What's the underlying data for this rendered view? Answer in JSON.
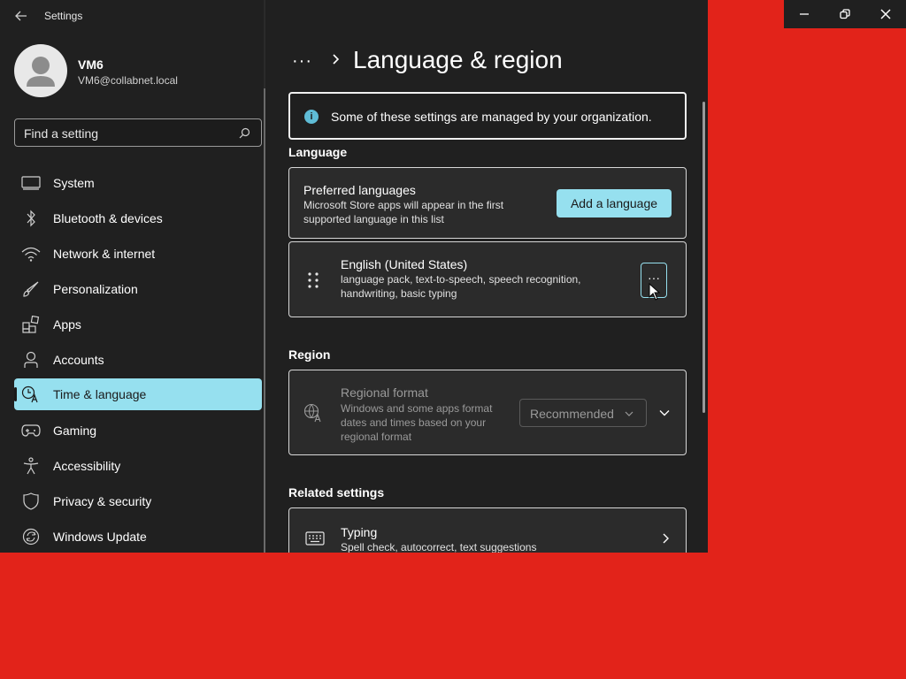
{
  "app": {
    "title": "Settings"
  },
  "user": {
    "name": "VM6",
    "email": "VM6@collabnet.local"
  },
  "search": {
    "text": "Find a setting"
  },
  "nav": {
    "items": [
      {
        "label": "System",
        "icon": "monitor-icon"
      },
      {
        "label": "Bluetooth & devices",
        "icon": "bluetooth-icon"
      },
      {
        "label": "Network & internet",
        "icon": "wifi-icon"
      },
      {
        "label": "Personalization",
        "icon": "brush-icon"
      },
      {
        "label": "Apps",
        "icon": "apps-icon"
      },
      {
        "label": "Accounts",
        "icon": "person-icon"
      },
      {
        "label": "Time & language",
        "icon": "time-language-icon",
        "active": true
      },
      {
        "label": "Gaming",
        "icon": "gamepad-icon"
      },
      {
        "label": "Accessibility",
        "icon": "accessibility-icon"
      },
      {
        "label": "Privacy & security",
        "icon": "shield-icon"
      },
      {
        "label": "Windows Update",
        "icon": "update-icon"
      }
    ]
  },
  "main": {
    "breadcrumb_more": "···",
    "title": "Language & region",
    "info": "Some of these settings are managed by your organization.",
    "language_section": "Language",
    "preferred": {
      "title": "Preferred languages",
      "desc": "Microsoft Store apps will appear in the first supported language in this list",
      "button": "Add a language"
    },
    "english": {
      "title": "English (United States)",
      "desc": "language pack, text-to-speech, speech recognition, handwriting, basic typing",
      "more": "···"
    },
    "region_section": "Region",
    "regional_format": {
      "title": "Regional format",
      "desc": "Windows and some apps format dates and times based on your regional format",
      "value": "Recommended"
    },
    "related_section": "Related settings",
    "typing": {
      "title": "Typing",
      "desc": "Spell check, autocorrect, text suggestions"
    }
  },
  "colors": {
    "accent": "#96e0ef",
    "window_bg": "#202020",
    "card_bg": "#2b2b2b",
    "desktop_bg": "#e2231a"
  }
}
